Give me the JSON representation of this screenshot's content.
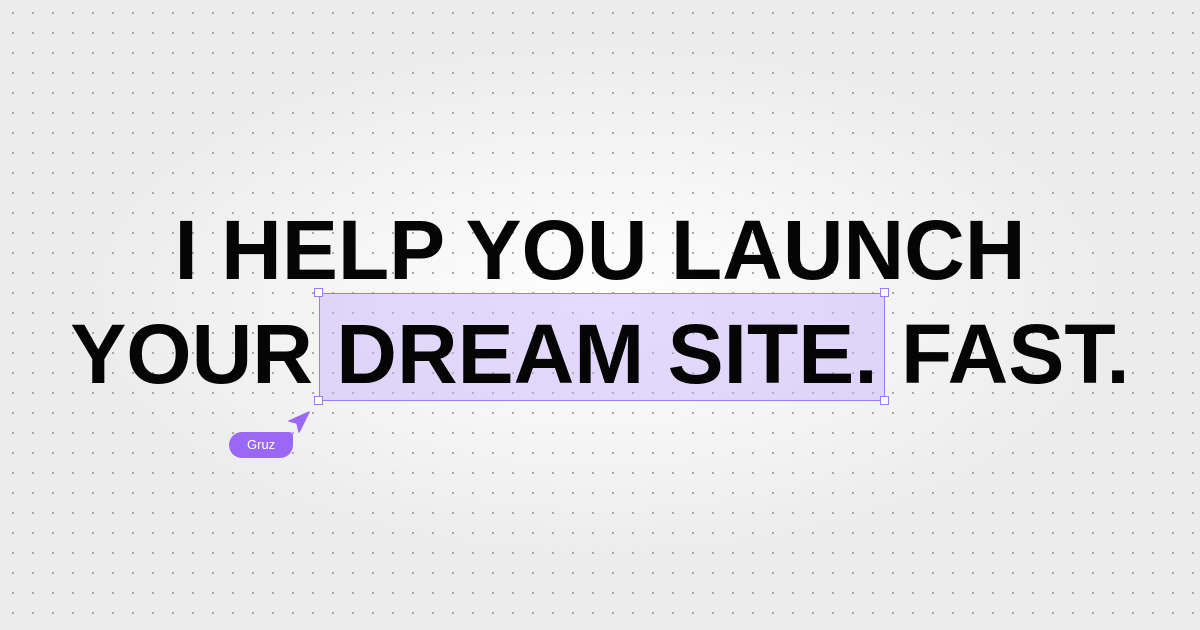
{
  "headline": {
    "line1": "I HELP YOU LAUNCH",
    "line2_before": "YOUR ",
    "line2_highlight": "DREAM SITE.",
    "line2_after": " FAST."
  },
  "cursor": {
    "icon": "cursor-arrow-icon",
    "label": "Gruz"
  },
  "colors": {
    "background": "#ececec",
    "text": "#050505",
    "selection_fill": "#dcd0fb",
    "selection_border": "#9b7cf2",
    "cursor_tag": "#9b68f5"
  }
}
